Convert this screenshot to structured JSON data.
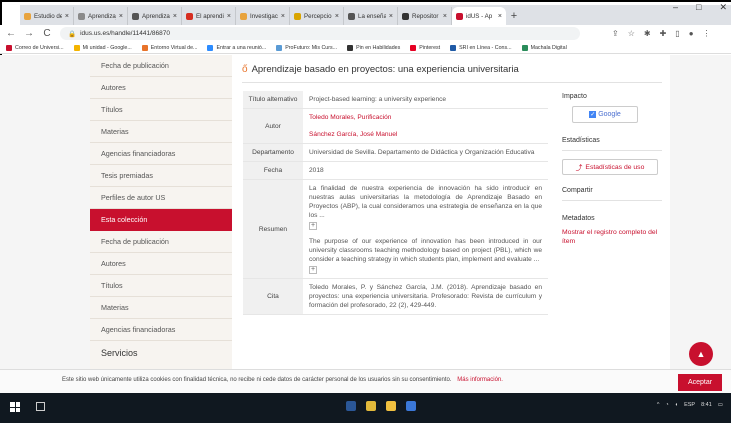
{
  "browser": {
    "tabs": [
      {
        "title": "Estudio de",
        "color": "#e8a33d"
      },
      {
        "title": "Aprendizaj",
        "color": "#8a8a8a"
      },
      {
        "title": "Aprendiza",
        "color": "#555555"
      },
      {
        "title": "El aprendi",
        "color": "#d62d20"
      },
      {
        "title": "Investigac",
        "color": "#e8a33d"
      },
      {
        "title": "Percepcio",
        "color": "#d9a400"
      },
      {
        "title": "La enseña",
        "color": "#555555"
      },
      {
        "title": "Repositor",
        "color": "#333333"
      },
      {
        "title": "idUS - Ap",
        "color": "#c8102e"
      }
    ],
    "new_tab": "+",
    "window_controls": {
      "minimize": "–",
      "maximize": "□",
      "close": "✕"
    },
    "back": "←",
    "forward": "→",
    "reload": "C",
    "url": "idus.us.es/handle/11441/86870",
    "bookmarks": [
      {
        "label": "Correo de Universi...",
        "color": "#c8102e"
      },
      {
        "label": "Mi unidad - Google...",
        "color": "#f4b400"
      },
      {
        "label": "Entorno Virtual de...",
        "color": "#e8732a"
      },
      {
        "label": "Entrar a una reunió...",
        "color": "#2d8cff"
      },
      {
        "label": "ProFuturo: Mis Curs...",
        "color": "#5a9bd5"
      },
      {
        "label": "Pin en Habilidades",
        "color": "#333333"
      },
      {
        "label": "Pinterest",
        "color": "#e60023"
      },
      {
        "label": "SRI en Línea - Cons...",
        "color": "#1f5aa6"
      },
      {
        "label": "Machala Digital",
        "color": "#2a8c5a"
      }
    ]
  },
  "sidebar": {
    "items_top": [
      "Fecha de publicación",
      "Autores",
      "Títulos",
      "Materias",
      "Agencias financiadoras",
      "Tesis premiadas",
      "Perfiles de autor US"
    ],
    "active": "Esta colección",
    "items_bottom": [
      "Fecha de publicación",
      "Autores",
      "Títulos",
      "Materias",
      "Agencias financiadoras"
    ],
    "services_heading": "Servicios"
  },
  "record": {
    "title": "Aprendizaje basado en proyectos: una experiencia universitaria",
    "alt_title_label": "Título alternativo",
    "alt_title": "Project-based learning: a university experience",
    "author_label": "Autor",
    "authors": [
      "Toledo Morales, Purificación",
      "Sánchez García, José Manuel"
    ],
    "dept_label": "Departamento",
    "dept": "Universidad de Sevilla. Departamento de Didáctica y Organización Educativa",
    "date_label": "Fecha",
    "date": "2018",
    "abstract_label": "Resumen",
    "abstract_es": "La finalidad de nuestra experiencia de innovación ha sido introducir en nuestras aulas universitarias la metodología de Aprendizaje Basado en Proyectos (ABP), la cual consideramos una estrategia de enseñanza en la que los ...",
    "abstract_en": "The purpose of our experience of innovation has been introduced in our university classrooms teaching methodology based on project (PBL), which we consider a teaching strategy in which students plan, implement and evaluate ...",
    "expand": "+",
    "cite_label": "Cita",
    "cite": "Toledo Morales, P. y Sánchez García, J.M. (2018). Aprendizaje basado en proyectos: una experiencia universitaria. Profesorado: Revista de currículum y formación del profesorado, 22 (2), 429-449."
  },
  "right_panel": {
    "impact_heading": "Impacto",
    "google_label": "Google",
    "stats_heading": "Estadísticas",
    "stats_button": "Estadísticas de uso",
    "share_heading": "Compartir",
    "metadata_heading": "Metadatos",
    "metadata_link": "Mostrar el registro completo del ítem"
  },
  "cookie": {
    "text": "Este sitio web únicamente utiliza cookies con finalidad técnica, no recibe ni cede datos de carácter personal de los usuarios sin su consentimiento.",
    "more": "Más información.",
    "accept": "Aceptar"
  },
  "taskbar": {
    "tray": [
      "^",
      "ESP",
      "8:41"
    ]
  }
}
